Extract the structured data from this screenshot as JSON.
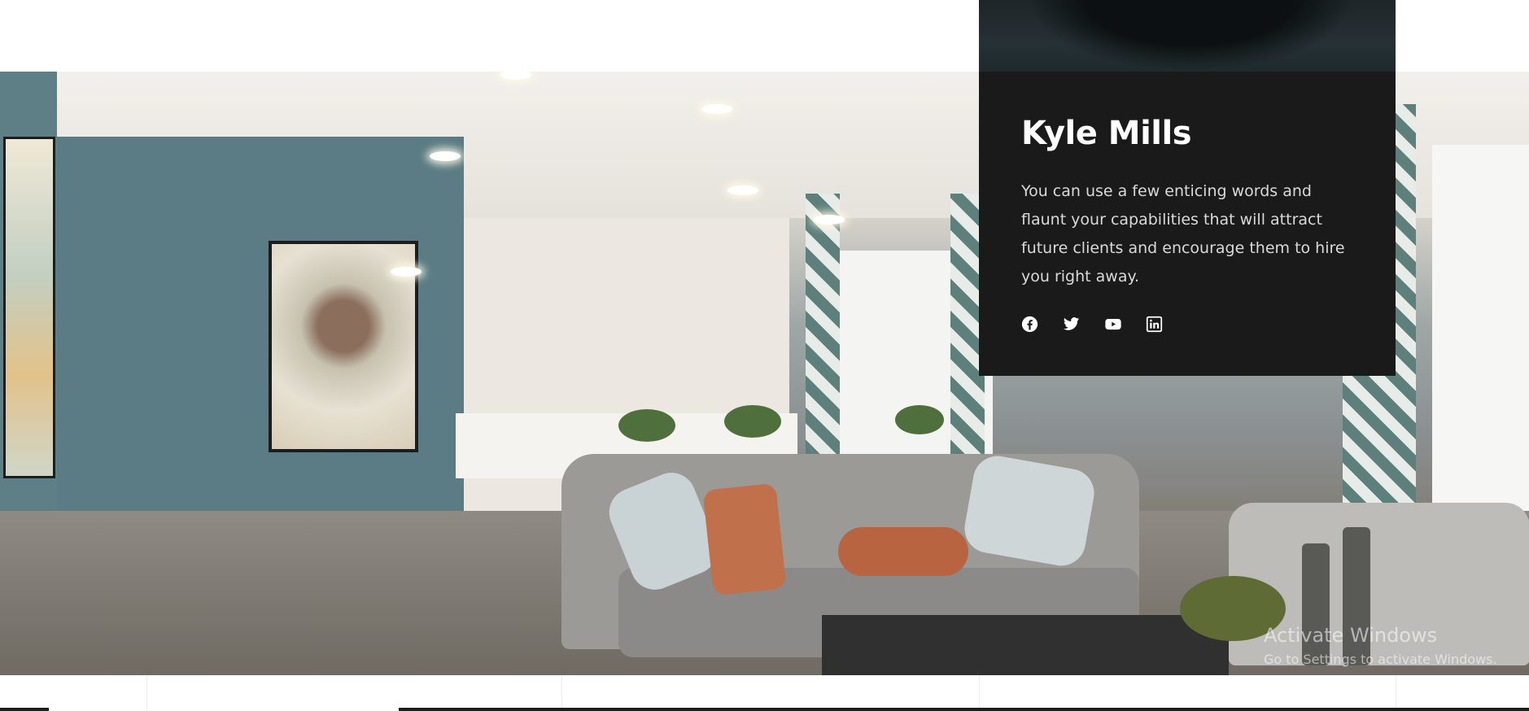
{
  "profile": {
    "name": "Kyle Mills",
    "bio": "You can use a few enticing words and flaunt your capabilities that will attract future clients and encourage them to hire you right away."
  },
  "social_icons": [
    "facebook-icon",
    "twitter-icon",
    "youtube-icon",
    "linkedin-icon"
  ],
  "watermark": {
    "title": "Activate Windows",
    "subtitle": "Go to Settings to activate Windows."
  },
  "colors": {
    "card_background": "#1a1a1a",
    "card_title": "#ffffff",
    "card_text": "#d9d9d9"
  }
}
